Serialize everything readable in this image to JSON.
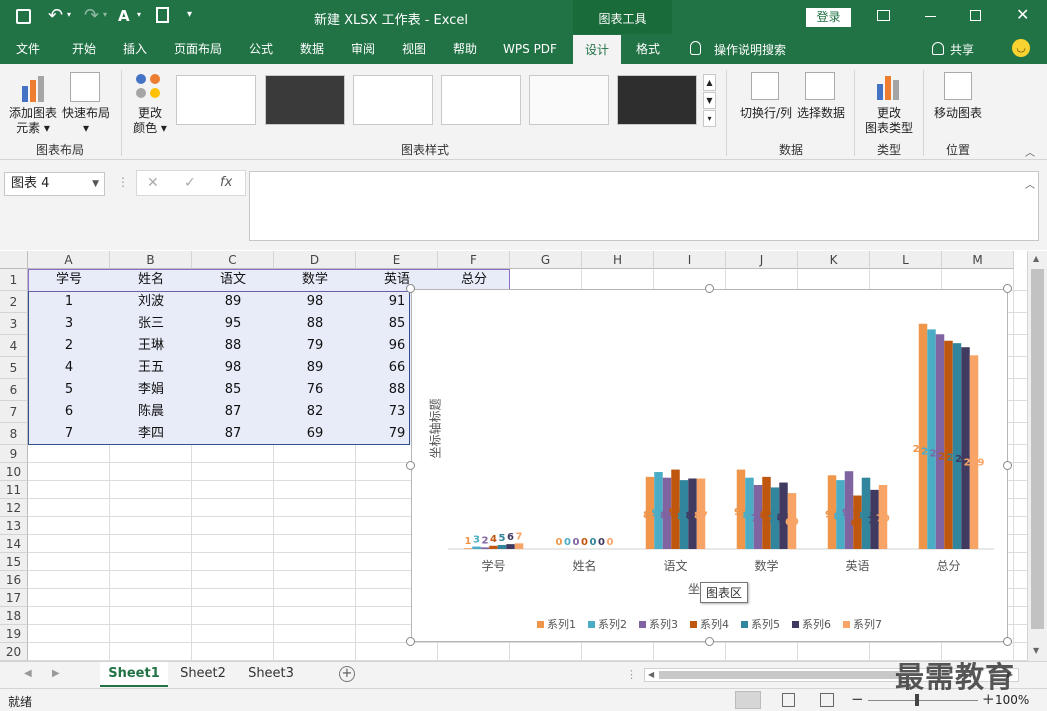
{
  "window": {
    "title": "新建 XLSX 工作表  -  Excel",
    "context_tab": "图表工具",
    "login_label": "登录"
  },
  "tabs": [
    "文件",
    "开始",
    "插入",
    "页面布局",
    "公式",
    "数据",
    "审阅",
    "视图",
    "帮助",
    "WPS PDF",
    "设计",
    "格式"
  ],
  "tell_me": "操作说明搜索",
  "share": "共享",
  "ribbon": {
    "add_element": [
      "添加图表",
      "元素"
    ],
    "quick_layout": "快速布局",
    "change_colors": [
      "更改",
      "颜色"
    ],
    "group_layout": "图表布局",
    "group_styles": "图表样式",
    "switch_row_col": "切换行/列",
    "select_data": "选择数据",
    "group_data": "数据",
    "change_type": [
      "更改",
      "图表类型"
    ],
    "group_type": "类型",
    "move_chart": "移动图表",
    "group_location": "位置"
  },
  "name_box": "图表 4",
  "formula_icons": [
    "✕",
    "✓",
    "fx"
  ],
  "columns": [
    "A",
    "B",
    "C",
    "D",
    "E",
    "F",
    "G",
    "H",
    "I",
    "J",
    "K",
    "L",
    "M"
  ],
  "rows": [
    "1",
    "2",
    "3",
    "4",
    "5",
    "6",
    "7",
    "8",
    "9",
    "10",
    "11",
    "12",
    "13",
    "14",
    "15",
    "16",
    "17",
    "18",
    "19",
    "20"
  ],
  "table": {
    "headers": [
      "学号",
      "姓名",
      "语文",
      "数学",
      "英语",
      "总分"
    ],
    "rows": [
      [
        "1",
        "刘波",
        "89",
        "98",
        "91"
      ],
      [
        "3",
        "张三",
        "95",
        "88",
        "85"
      ],
      [
        "2",
        "王琳",
        "88",
        "79",
        "96"
      ],
      [
        "4",
        "王五",
        "98",
        "89",
        "66"
      ],
      [
        "5",
        "李娟",
        "85",
        "76",
        "88"
      ],
      [
        "6",
        "陈晨",
        "87",
        "82",
        "73"
      ],
      [
        "7",
        "李四",
        "87",
        "69",
        "79"
      ]
    ]
  },
  "chart_data": {
    "type": "bar",
    "categories": [
      "学号",
      "姓名",
      "语文",
      "数学",
      "英语",
      "总分"
    ],
    "series": [
      {
        "name": "系列1",
        "values": [
          1,
          0,
          89,
          98,
          91,
          278
        ]
      },
      {
        "name": "系列2",
        "values": [
          3,
          0,
          95,
          88,
          85,
          271
        ]
      },
      {
        "name": "系列3",
        "values": [
          2,
          0,
          88,
          79,
          96,
          265
        ]
      },
      {
        "name": "系列4",
        "values": [
          4,
          0,
          98,
          89,
          66,
          257
        ]
      },
      {
        "name": "系列5",
        "values": [
          5,
          0,
          85,
          76,
          88,
          254
        ]
      },
      {
        "name": "系列6",
        "values": [
          6,
          0,
          87,
          82,
          73,
          249
        ]
      },
      {
        "name": "系列7",
        "values": [
          7,
          0,
          87,
          69,
          79,
          239
        ]
      }
    ],
    "ylabel": "坐标轴标题",
    "xlabel_partial": "坐",
    "tooltip": "图表区",
    "legend_position": "bottom",
    "colors": [
      "#f0964a",
      "#4bacc6",
      "#8064a2",
      "#c0570e",
      "#31859c",
      "#403a60",
      "#f8a466"
    ],
    "grid": false
  },
  "sheets": [
    "Sheet1",
    "Sheet2",
    "Sheet3"
  ],
  "status": {
    "ready": "就绪",
    "zoom": "100%"
  },
  "watermark": "最需教育",
  "colors": {
    "accent": "#217346",
    "selection": "#e8ecf9"
  }
}
